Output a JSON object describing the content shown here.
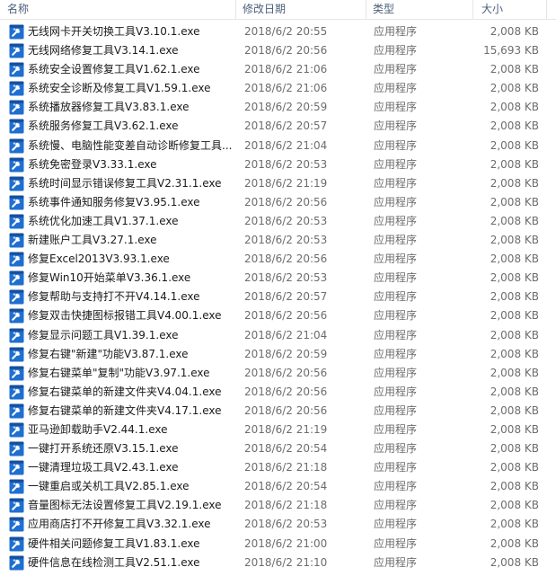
{
  "columns": {
    "name": "名称",
    "date": "修改日期",
    "type": "类型",
    "size": "大小"
  },
  "accent_color": "#1f6fd1",
  "icon": "exe-tool-icon",
  "files": [
    {
      "name": "无线网卡开关切换工具V3.10.1.exe",
      "date": "2018/6/2 20:55",
      "type": "应用程序",
      "size": "2,008 KB"
    },
    {
      "name": "无线网络修复工具V3.14.1.exe",
      "date": "2018/6/2 20:56",
      "type": "应用程序",
      "size": "15,693 KB"
    },
    {
      "name": "系统安全设置修复工具V1.62.1.exe",
      "date": "2018/6/2 21:06",
      "type": "应用程序",
      "size": "2,008 KB"
    },
    {
      "name": "系统安全诊断及修复工具V1.59.1.exe",
      "date": "2018/6/2 21:06",
      "type": "应用程序",
      "size": "2,008 KB"
    },
    {
      "name": "系统播放器修复工具V3.83.1.exe",
      "date": "2018/6/2 20:59",
      "type": "应用程序",
      "size": "2,008 KB"
    },
    {
      "name": "系统服务修复工具V3.62.1.exe",
      "date": "2018/6/2 20:57",
      "type": "应用程序",
      "size": "2,008 KB"
    },
    {
      "name": "系统慢、电脑性能变差自动诊断修复工具...",
      "date": "2018/6/2 21:04",
      "type": "应用程序",
      "size": "2,008 KB"
    },
    {
      "name": "系统免密登录V3.33.1.exe",
      "date": "2018/6/2 20:53",
      "type": "应用程序",
      "size": "2,008 KB"
    },
    {
      "name": "系统时间显示错误修复工具V2.31.1.exe",
      "date": "2018/6/2 21:19",
      "type": "应用程序",
      "size": "2,008 KB"
    },
    {
      "name": "系统事件通知服务修复V3.95.1.exe",
      "date": "2018/6/2 20:56",
      "type": "应用程序",
      "size": "2,008 KB"
    },
    {
      "name": "系统优化加速工具V1.37.1.exe",
      "date": "2018/6/2 20:53",
      "type": "应用程序",
      "size": "2,008 KB"
    },
    {
      "name": "新建账户工具V3.27.1.exe",
      "date": "2018/6/2 20:53",
      "type": "应用程序",
      "size": "2,008 KB"
    },
    {
      "name": "修复Excel2013V3.93.1.exe",
      "date": "2018/6/2 20:56",
      "type": "应用程序",
      "size": "2,008 KB"
    },
    {
      "name": "修复Win10开始菜单V3.36.1.exe",
      "date": "2018/6/2 20:53",
      "type": "应用程序",
      "size": "2,008 KB"
    },
    {
      "name": "修复帮助与支持打不开V4.14.1.exe",
      "date": "2018/6/2 20:57",
      "type": "应用程序",
      "size": "2,008 KB"
    },
    {
      "name": "修复双击快捷图标报错工具V4.00.1.exe",
      "date": "2018/6/2 20:56",
      "type": "应用程序",
      "size": "2,008 KB"
    },
    {
      "name": "修复显示问题工具V1.39.1.exe",
      "date": "2018/6/2 21:04",
      "type": "应用程序",
      "size": "2,008 KB"
    },
    {
      "name": "修复右键\"新建\"功能V3.87.1.exe",
      "date": "2018/6/2 20:59",
      "type": "应用程序",
      "size": "2,008 KB"
    },
    {
      "name": "修复右键菜单\"复制\"功能V3.97.1.exe",
      "date": "2018/6/2 20:56",
      "type": "应用程序",
      "size": "2,008 KB"
    },
    {
      "name": "修复右键菜单的新建文件夹V4.04.1.exe",
      "date": "2018/6/2 20:56",
      "type": "应用程序",
      "size": "2,008 KB"
    },
    {
      "name": "修复右键菜单的新建文件夹V4.17.1.exe",
      "date": "2018/6/2 20:56",
      "type": "应用程序",
      "size": "2,008 KB"
    },
    {
      "name": "亚马逊卸载助手V2.44.1.exe",
      "date": "2018/6/2 21:19",
      "type": "应用程序",
      "size": "2,008 KB"
    },
    {
      "name": "一键打开系统还原V3.15.1.exe",
      "date": "2018/6/2 20:54",
      "type": "应用程序",
      "size": "2,008 KB"
    },
    {
      "name": "一键清理垃圾工具V2.43.1.exe",
      "date": "2018/6/2 21:18",
      "type": "应用程序",
      "size": "2,008 KB"
    },
    {
      "name": "一键重启或关机工具V2.85.1.exe",
      "date": "2018/6/2 20:54",
      "type": "应用程序",
      "size": "2,008 KB"
    },
    {
      "name": "音量图标无法设置修复工具V2.19.1.exe",
      "date": "2018/6/2 21:18",
      "type": "应用程序",
      "size": "2,008 KB"
    },
    {
      "name": "应用商店打不开修复工具V3.32.1.exe",
      "date": "2018/6/2 20:53",
      "type": "应用程序",
      "size": "2,008 KB"
    },
    {
      "name": "硬件相关问题修复工具V1.83.1.exe",
      "date": "2018/6/2 21:00",
      "type": "应用程序",
      "size": "2,008 KB"
    },
    {
      "name": "硬件信息在线检测工具V2.51.1.exe",
      "date": "2018/6/2 21:10",
      "type": "应用程序",
      "size": "2,008 KB"
    }
  ]
}
